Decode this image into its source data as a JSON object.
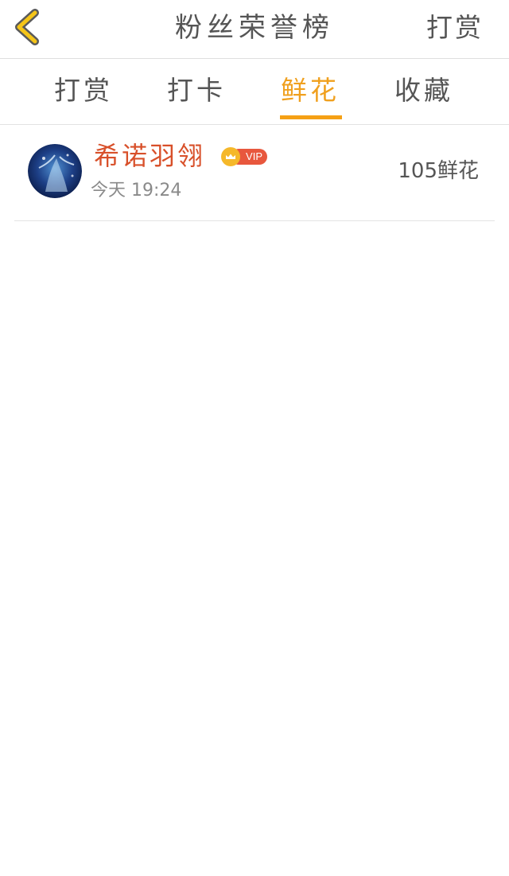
{
  "header": {
    "title": "粉丝荣誉榜",
    "action_label": "打赏",
    "back_icon": "chevron-left-icon",
    "back_icon_color": "#f5c518"
  },
  "tabs": [
    {
      "label": "打赏",
      "active": false
    },
    {
      "label": "打卡",
      "active": false
    },
    {
      "label": "鲜花",
      "active": true
    },
    {
      "label": "收藏",
      "active": false
    }
  ],
  "colors": {
    "accent": "#f0a01e",
    "name": "#d8502a",
    "vip": "#e8573d"
  },
  "list": [
    {
      "name": "希诺羽翎",
      "vip_label": "VIP",
      "time": "今天  19:24",
      "count": "105鲜花"
    }
  ]
}
